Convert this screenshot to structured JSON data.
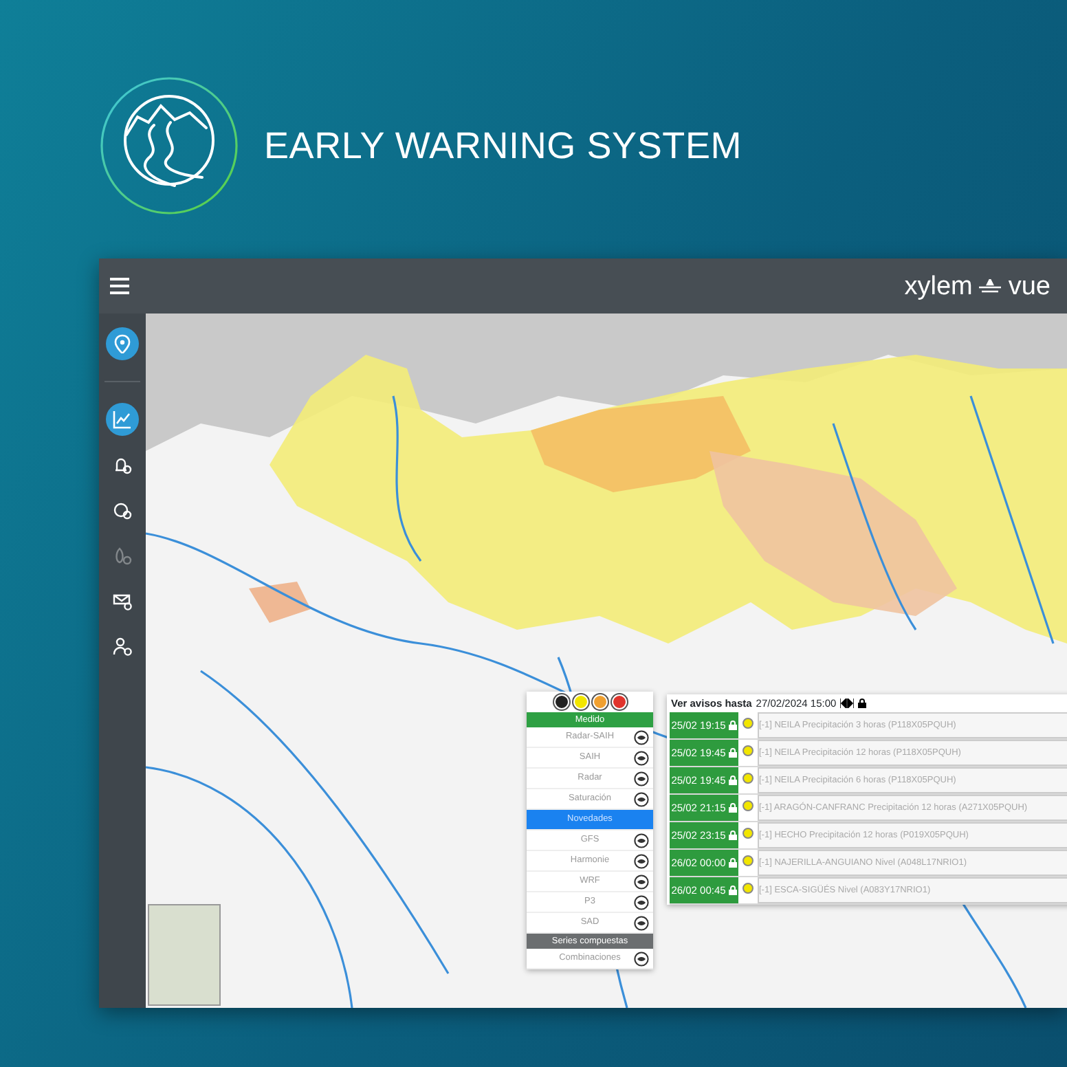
{
  "brand": {
    "title": "EARLY WARNING SYSTEM"
  },
  "app": {
    "logo_left": "xylem",
    "logo_right": "vue"
  },
  "sidebar": {
    "items": [
      {
        "kind": "pin",
        "selected": true,
        "disabled": false
      },
      {
        "kind": "chart",
        "selected": true,
        "disabled": false
      },
      {
        "kind": "bell",
        "selected": false,
        "disabled": false
      },
      {
        "kind": "gauge",
        "selected": false,
        "disabled": false
      },
      {
        "kind": "drop",
        "selected": false,
        "disabled": true
      },
      {
        "kind": "mail",
        "selected": false,
        "disabled": false
      },
      {
        "kind": "user",
        "selected": false,
        "disabled": false
      }
    ]
  },
  "layers_panel": {
    "filters": [
      {
        "color": "#222222"
      },
      {
        "color": "#f2e600"
      },
      {
        "color": "#f0a030"
      },
      {
        "color": "#e0342c"
      }
    ],
    "items": [
      {
        "kind": "section",
        "label": "Medido",
        "color": "#2ea043"
      },
      {
        "kind": "layer",
        "label": "Radar-SAIH",
        "selected": false
      },
      {
        "kind": "layer",
        "label": "SAIH",
        "selected": false
      },
      {
        "kind": "layer",
        "label": "Radar",
        "selected": false
      },
      {
        "kind": "layer",
        "label": "Saturación",
        "selected": false
      },
      {
        "kind": "layer",
        "label": "Novedades",
        "selected": true
      },
      {
        "kind": "layer",
        "label": "GFS",
        "selected": false
      },
      {
        "kind": "layer",
        "label": "Harmonie",
        "selected": false
      },
      {
        "kind": "layer",
        "label": "WRF",
        "selected": false
      },
      {
        "kind": "layer",
        "label": "P3",
        "selected": false
      },
      {
        "kind": "layer",
        "label": "SAD",
        "selected": false
      },
      {
        "kind": "section",
        "label": "Series compuestas",
        "color": "#6b6e70"
      },
      {
        "kind": "layer",
        "label": "Combinaciones",
        "selected": false
      }
    ]
  },
  "alerts": {
    "label": "Ver avisos hasta",
    "date": "27/02/2024 15:00",
    "items": [
      {
        "time": "25/02 19:15",
        "color": "#f2e600",
        "text": "[-1] NEILA Precipitación 3 horas (P118X05PQUH)"
      },
      {
        "time": "25/02 19:45",
        "color": "#f2e600",
        "text": "[-1] NEILA Precipitación 12 horas (P118X05PQUH)"
      },
      {
        "time": "25/02 19:45",
        "color": "#f2e600",
        "text": "[-1] NEILA Precipitación 6 horas (P118X05PQUH)"
      },
      {
        "time": "25/02 21:15",
        "color": "#f2e600",
        "text": "[-1] ARAGÓN-CANFRANC Precipitación 12 horas (A271X05PQUH)"
      },
      {
        "time": "25/02 23:15",
        "color": "#f2e600",
        "text": "[-1] HECHO Precipitación 12 horas (P019X05PQUH)"
      },
      {
        "time": "26/02 00:00",
        "color": "#f2e600",
        "text": "[-1] NAJERILLA-ANGUIANO Nivel (A048L17NRIO1)"
      },
      {
        "time": "26/02 00:45",
        "color": "#f2e600",
        "text": "[-1] ESCA-SIGÜÉS Nivel (A083Y17NRIO1)"
      }
    ]
  }
}
